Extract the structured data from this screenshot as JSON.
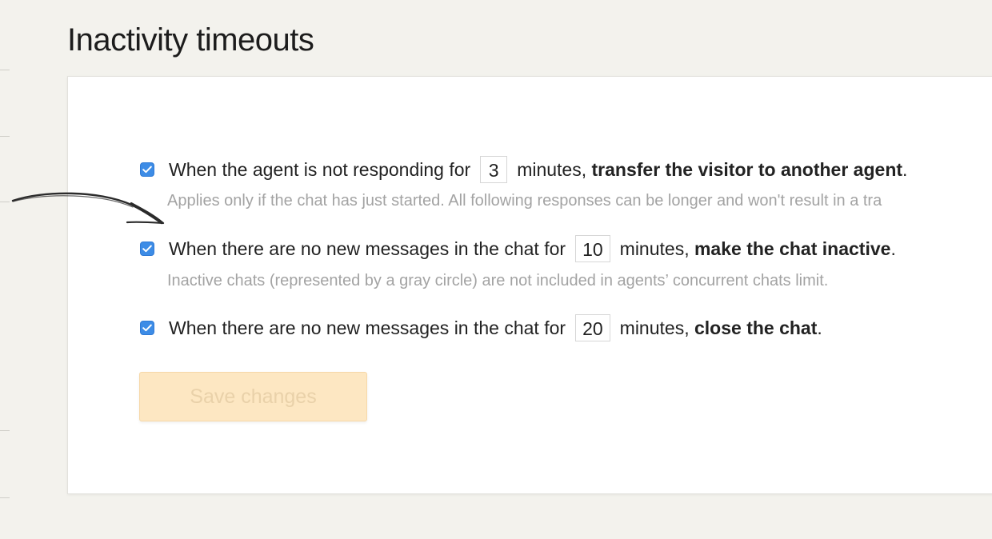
{
  "page": {
    "title": "Inactivity timeouts"
  },
  "settings": [
    {
      "checked": true,
      "prefix": "When the agent is not responding for",
      "minutes": "3",
      "suffix": "minutes, ",
      "action": "transfer the visitor to another agent",
      "end": ".",
      "hint": "Applies only if the chat has just started. All following responses can be longer and won't result in a tra"
    },
    {
      "checked": true,
      "prefix": "When there are no new messages in the chat for",
      "minutes": "10",
      "suffix": "minutes, ",
      "action": "make the chat inactive",
      "end": ".",
      "hint": "Inactive chats (represented by a gray circle) are not included in agents’ concurrent chats limit."
    },
    {
      "checked": true,
      "prefix": "When there are no new messages in the chat for",
      "minutes": "20",
      "suffix": "minutes, ",
      "action": "close the chat",
      "end": "."
    }
  ],
  "save_button": {
    "label": "Save changes",
    "enabled": false
  },
  "colors": {
    "background": "#f3f2ed",
    "checkbox": "#3d8ce6",
    "save_button_bg": "#fde7c2",
    "save_button_text": "#e9d1a9",
    "hint_text": "#a3a3a3"
  },
  "icons": {
    "annotation": "hand-drawn-arrow-icon",
    "checkbox": "checkmark-icon"
  }
}
